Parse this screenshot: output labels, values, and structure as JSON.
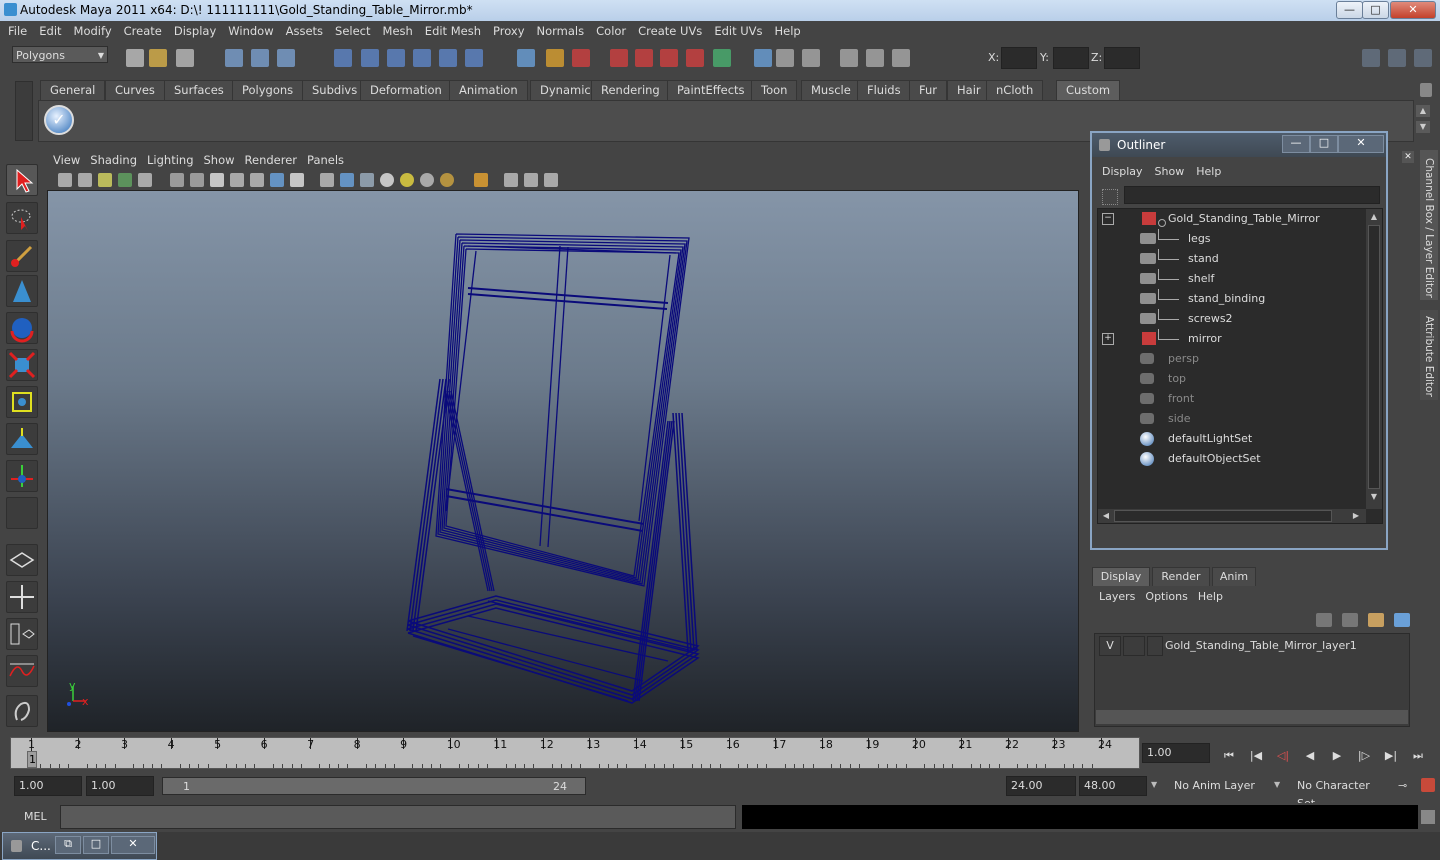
{
  "window": {
    "title": "Autodesk Maya 2011 x64: D:\\! 111111111\\Gold_Standing_Table_Mirror.mb*",
    "minimize": "—",
    "maximize": "□",
    "close": "✕"
  },
  "menubar": [
    "File",
    "Edit",
    "Modify",
    "Create",
    "Display",
    "Window",
    "Assets",
    "Select",
    "Mesh",
    "Edit Mesh",
    "Proxy",
    "Normals",
    "Color",
    "Create UVs",
    "Edit UVs",
    "Help"
  ],
  "statusline": {
    "mode": "Polygons",
    "x_label": "X:",
    "y_label": "Y:",
    "z_label": "Z:"
  },
  "shelf": {
    "tabs": [
      "General",
      "Curves",
      "Surfaces",
      "Polygons",
      "Subdivs",
      "Deformation",
      "Animation",
      "Dynamics",
      "Rendering",
      "PaintEffects",
      "Toon",
      "Muscle",
      "Fluids",
      "Fur",
      "Hair",
      "nCloth",
      "Custom"
    ],
    "active_tab": "Custom"
  },
  "viewport": {
    "menus": [
      "View",
      "Shading",
      "Lighting",
      "Show",
      "Renderer",
      "Panels"
    ],
    "axis_x": "x",
    "axis_y": "y",
    "wire_color": "#0a0a7a"
  },
  "outliner": {
    "title": "Outliner",
    "menus": [
      "Display",
      "Show",
      "Help"
    ],
    "root": "Gold_Standing_Table_Mirror",
    "children": [
      "legs",
      "stand",
      "shelf",
      "stand_binding",
      "screws2",
      "mirror"
    ],
    "cameras": [
      "persp",
      "top",
      "front",
      "side"
    ],
    "sets": [
      "defaultLightSet",
      "defaultObjectSet"
    ],
    "expand_minus": "−",
    "expand_plus": "+"
  },
  "side_tabs": {
    "channel_box": "Channel Box / Layer Editor",
    "attribute_editor": "Attribute Editor"
  },
  "layer_editor": {
    "tabs": [
      "Display",
      "Render",
      "Anim"
    ],
    "active_tab": "Display",
    "menus": [
      "Layers",
      "Options",
      "Help"
    ],
    "layer_visibility": "V",
    "layer_name": "Gold_Standing_Table_Mirror_layer1"
  },
  "timeline": {
    "ticks": [
      "1",
      "2",
      "3",
      "4",
      "5",
      "6",
      "7",
      "8",
      "9",
      "10",
      "11",
      "12",
      "13",
      "14",
      "15",
      "16",
      "17",
      "18",
      "19",
      "20",
      "21",
      "22",
      "23",
      "24"
    ],
    "current_frame": "1",
    "current_time_field": "1.00"
  },
  "range": {
    "start": "1.00",
    "playback_start": "1.00",
    "slider_start": "1",
    "slider_end": "24",
    "playback_end": "24.00",
    "end": "48.00",
    "anim_layer": "No Anim Layer",
    "character_set": "No Character Set"
  },
  "command_line": {
    "label": "MEL"
  },
  "taskbar": {
    "item": "C..."
  },
  "colors": {
    "bg": "#444444",
    "accent": "#8aa5c4"
  }
}
